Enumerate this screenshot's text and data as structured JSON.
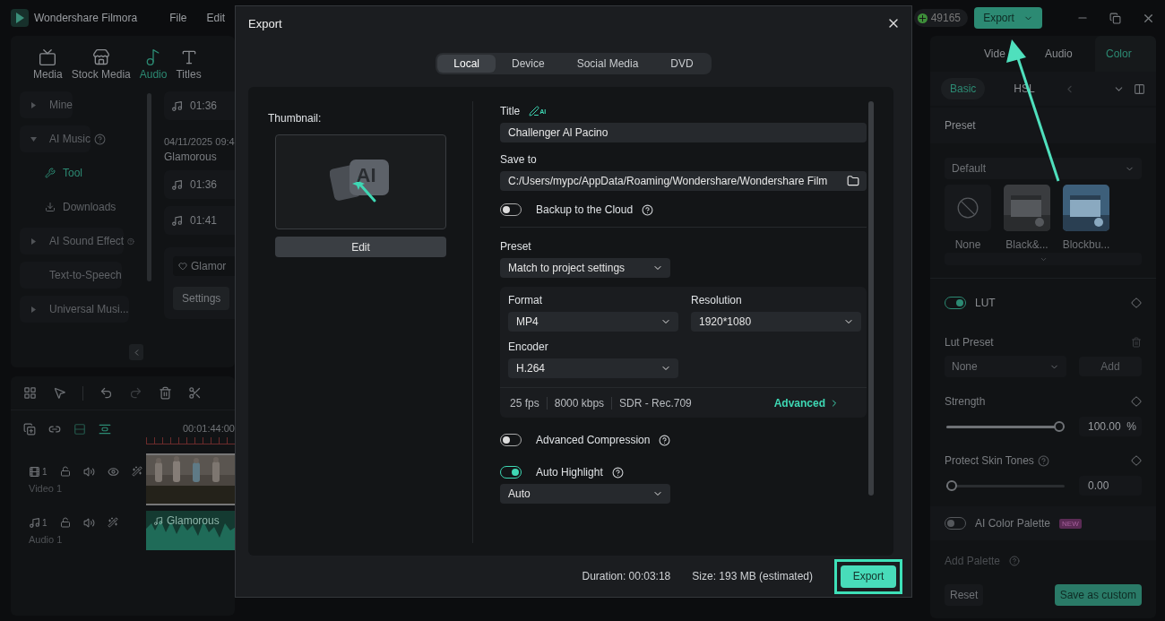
{
  "app": {
    "name": "Wondershare Filmora",
    "menu": [
      "File",
      "Edit"
    ],
    "credits": "49165",
    "export_button": "Export"
  },
  "media_tabs": [
    {
      "label": "Media",
      "selected": false
    },
    {
      "label": "Stock Media",
      "selected": false
    },
    {
      "label": "Audio",
      "selected": true
    },
    {
      "label": "Titles",
      "selected": false
    }
  ],
  "library_sidebar": [
    {
      "label": "Mine",
      "kind": "group",
      "expanded": false,
      "help": false
    },
    {
      "label": "AI Music",
      "kind": "group",
      "expanded": true,
      "help": true,
      "children": [
        {
          "label": "Tool",
          "selected": true
        },
        {
          "label": "Downloads",
          "selected": false
        }
      ]
    },
    {
      "label": "AI Sound Effect",
      "kind": "group",
      "expanded": false,
      "help": true
    },
    {
      "label": "Text-to-Speech",
      "kind": "plain",
      "help": false
    },
    {
      "label": "Universal Musi...",
      "kind": "group",
      "expanded": false,
      "help": false
    }
  ],
  "audio_list": [
    {
      "kind": "track",
      "duration": "01:36"
    },
    {
      "kind": "heading",
      "date": "04/11/2025 09:4",
      "title": "Glamorous"
    },
    {
      "kind": "track",
      "duration": "01:36"
    },
    {
      "kind": "track",
      "duration": "01:41"
    },
    {
      "kind": "settings",
      "chip": "Glamor",
      "button": "Settings"
    }
  ],
  "timeline": {
    "timecode": "00:01:44:00",
    "tracks": [
      {
        "kind": "video",
        "number": "1",
        "name": "Video 1"
      },
      {
        "kind": "audio",
        "number": "1",
        "name": "Audio 1",
        "clip": "Glamorous"
      }
    ]
  },
  "properties": {
    "tabs": [
      {
        "label": "Vide",
        "selected": false
      },
      {
        "label": "Audio",
        "selected": false
      },
      {
        "label": "Color",
        "selected": true
      }
    ],
    "subtabs": [
      {
        "label": "Basic",
        "selected": true
      },
      {
        "label": "HSL",
        "selected": false
      }
    ],
    "preset_heading": "Preset",
    "preset_dropdown": "Default",
    "presets": [
      {
        "kind": "none",
        "label": "None"
      },
      {
        "kind": "mono",
        "label": "Black&..."
      },
      {
        "kind": "color",
        "label": "Blockbu..."
      }
    ],
    "lut": {
      "label": "LUT",
      "on": true
    },
    "lut_preset": {
      "label": "Lut Preset",
      "value": "None",
      "button": "Add"
    },
    "sliders": [
      {
        "label": "Strength",
        "help": false,
        "level": 1,
        "value": "100.00",
        "unit": "%"
      },
      {
        "label": "Protect Skin Tones",
        "help": true,
        "level": 0,
        "value": "0.00"
      }
    ],
    "ai_palette": {
      "label": "AI Color Palette",
      "on": false,
      "badge": "NEW"
    },
    "add_palette": {
      "label": "Add Palette",
      "disabled": true
    },
    "reset": "Reset",
    "save": "Save as custom"
  },
  "export_dialog": {
    "title": "Export",
    "tabs": [
      {
        "label": "Local",
        "selected": true
      },
      {
        "label": "Device",
        "selected": false
      },
      {
        "label": "Social Media",
        "selected": false
      },
      {
        "label": "DVD",
        "selected": false
      }
    ],
    "thumbnail_label": "Thumbnail:",
    "thumbnail_icon_text": "AI",
    "edit_button": "Edit",
    "title_label": "Title",
    "title_badge": "AI",
    "title_value": "Challenger Al Pacino",
    "save_to_label": "Save to",
    "save_to_value": "C:/Users/mypc/AppData/Roaming/Wondershare/Wondershare Film",
    "backup": {
      "label": "Backup to the Cloud",
      "on": false
    },
    "preset": {
      "label": "Preset",
      "value": "Match to project settings"
    },
    "format": {
      "label": "Format",
      "value": "MP4"
    },
    "resolution": {
      "label": "Resolution",
      "value": "1920*1080"
    },
    "encoder": {
      "label": "Encoder",
      "value": "H.264"
    },
    "specs": [
      "25 fps",
      "8000 kbps",
      "SDR - Rec.709"
    ],
    "advanced_link": "Advanced",
    "options": [
      {
        "label": "Advanced Compression",
        "on": false
      },
      {
        "label": "Auto Highlight",
        "on": true,
        "value": "Auto"
      }
    ],
    "duration": "Duration:  00:03:18",
    "size": "Size:  193 MB (estimated)",
    "export_button": "Export"
  }
}
